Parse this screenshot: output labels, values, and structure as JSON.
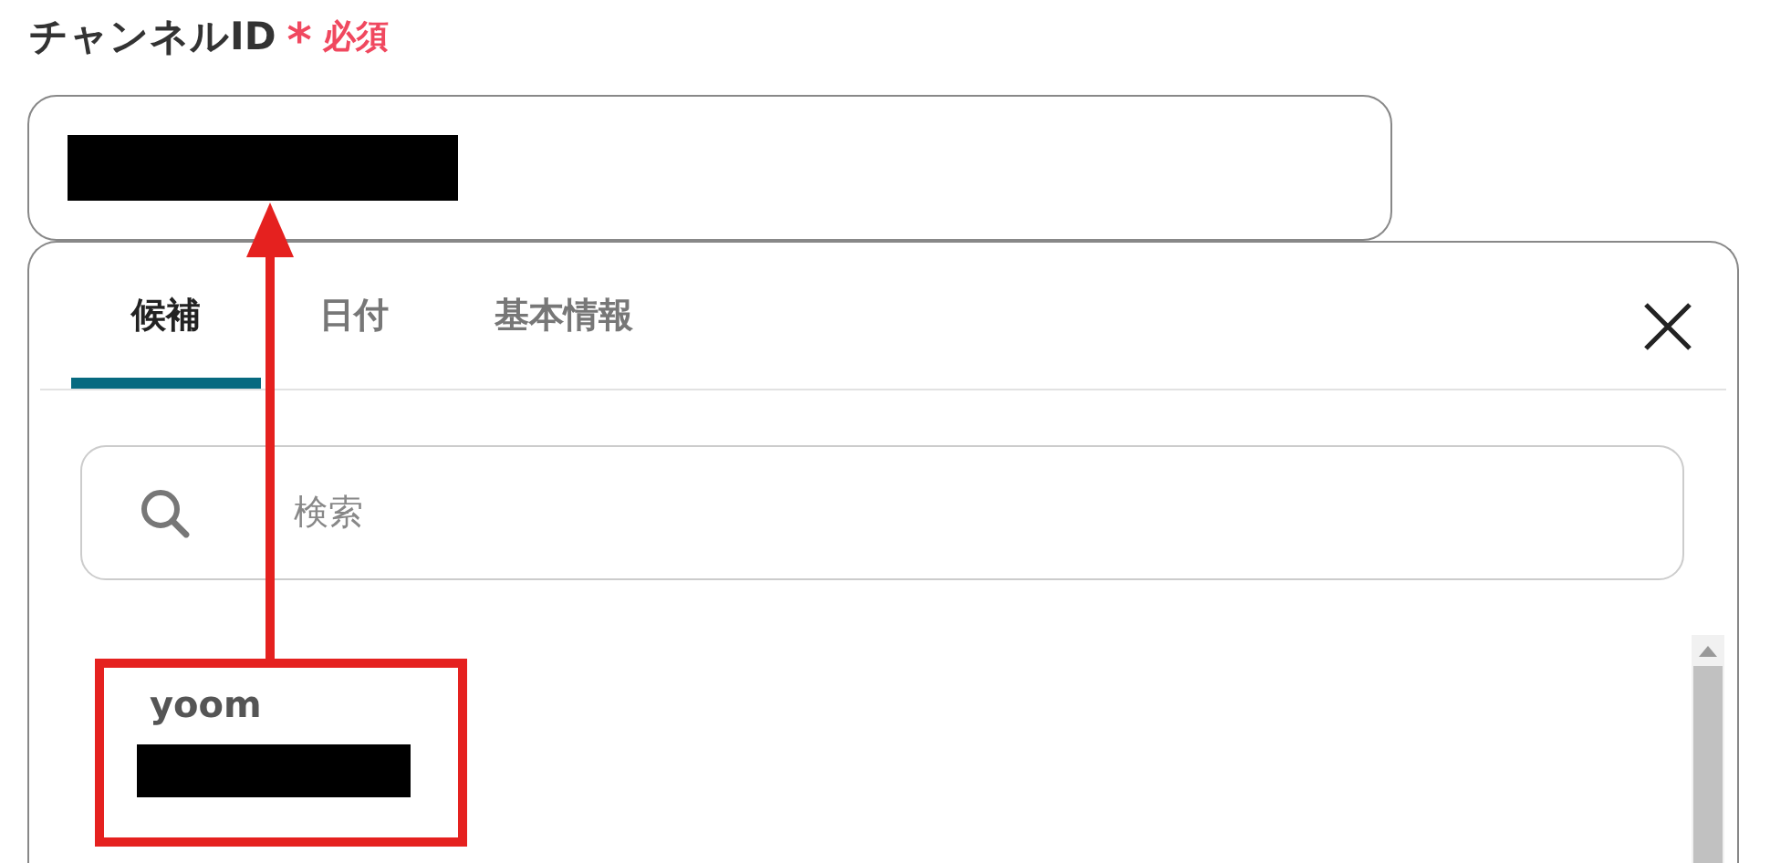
{
  "field": {
    "label": "チャンネルID",
    "required_mark": "*",
    "required_label": "必須"
  },
  "tabs": [
    {
      "label": "候補",
      "selected": true
    },
    {
      "label": "日付",
      "selected": false
    },
    {
      "label": "基本情報",
      "selected": false
    }
  ],
  "search": {
    "placeholder": "検索"
  },
  "items": [
    {
      "name": "yoom"
    }
  ]
}
